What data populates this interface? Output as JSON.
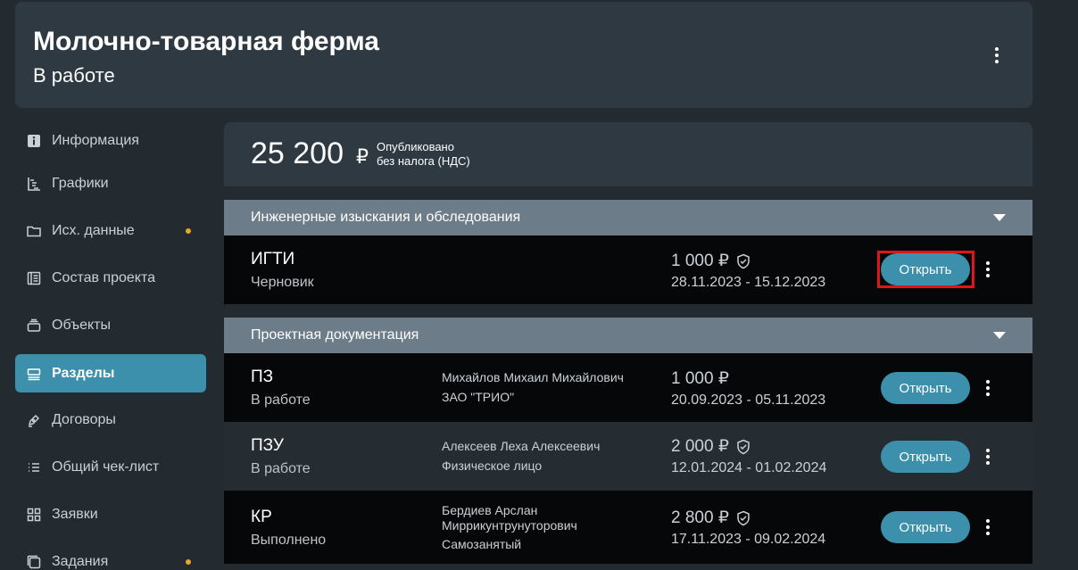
{
  "header": {
    "title": "Молочно-товарная ферма",
    "status": "В работе"
  },
  "sidebar": {
    "items": [
      {
        "label": "Информация",
        "icon": "info-icon",
        "active": false,
        "dot": false
      },
      {
        "label": "Графики",
        "icon": "gantt-chart-icon",
        "active": false,
        "dot": false
      },
      {
        "label": "Исх. данные",
        "icon": "folder-icon",
        "active": false,
        "dot": true
      },
      {
        "label": "Состав проекта",
        "icon": "document-list-icon",
        "active": false,
        "dot": false
      },
      {
        "label": "Объекты",
        "icon": "objects-stack-icon",
        "active": false,
        "dot": false
      },
      {
        "label": "Разделы",
        "icon": "sections-icon",
        "active": true,
        "dot": false
      },
      {
        "label": "Договоры",
        "icon": "pen-icon",
        "active": false,
        "dot": false
      },
      {
        "label": "Общий чек-лист",
        "icon": "checklist-icon",
        "active": false,
        "dot": false
      },
      {
        "label": "Заявки",
        "icon": "grid-icon",
        "active": false,
        "dot": false
      },
      {
        "label": "Задания",
        "icon": "tasks-icon",
        "active": false,
        "dot": true
      }
    ],
    "dot_color": "#e8a62a"
  },
  "summary": {
    "amount": "25 200",
    "currency": "₽",
    "note_line1": "Опубликовано",
    "note_line2": "без налога (НДС)"
  },
  "groups": [
    {
      "title": "Инженерные изыскания и обследования",
      "rows": [
        {
          "code": "ИГТИ",
          "status": "Черновик",
          "people": [],
          "price": "1 000 ₽",
          "verified": true,
          "dates": "28.11.2023 - 15.12.2023",
          "button": "Открыть",
          "highlighted": true
        }
      ]
    },
    {
      "title": "Проектная документация",
      "rows": [
        {
          "code": "ПЗ",
          "status": "В работе",
          "people": [
            "Михайлов Михаил Михайлович",
            "ЗАО \"ТРИО\""
          ],
          "price": "1 000 ₽",
          "verified": false,
          "dates": "20.09.2023 - 05.11.2023",
          "button": "Открыть",
          "highlighted": false
        },
        {
          "code": "ПЗУ",
          "status": "В работе",
          "people": [
            "Алексеев Леха Алексеевич",
            "Физическое лицо"
          ],
          "price": "2 000 ₽",
          "verified": true,
          "dates": "12.01.2024 - 01.02.2024",
          "button": "Открыть",
          "highlighted": false
        },
        {
          "code": "КР",
          "status": "Выполнено",
          "people": [
            "Бердиев Арслан",
            "Миррикунтрунуторович",
            "Самозанятый"
          ],
          "price": "2 800 ₽",
          "verified": true,
          "dates": "17.11.2023 - 09.02.2024",
          "button": "Открыть",
          "highlighted": false
        }
      ]
    }
  ],
  "colors": {
    "background": "#232b31",
    "card": "#2e3941",
    "accent": "#3c90ab",
    "group_header": "#6c7d89",
    "highlight": "#e0141b"
  }
}
